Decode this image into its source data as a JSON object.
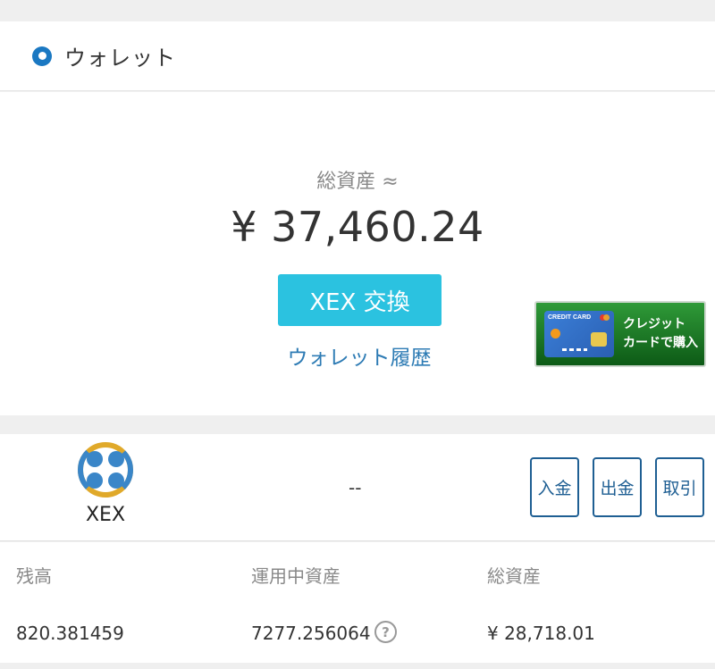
{
  "header": {
    "title": "ウォレット"
  },
  "summary": {
    "total_label": "総資産 ≈",
    "total_value": "¥ 37,460.24",
    "exchange_button": "XEX 交換",
    "history_link": "ウォレット履歴"
  },
  "banner": {
    "card_text": "CREDIT CARD",
    "line1": "クレジット",
    "line2": "カードで購入"
  },
  "coin": {
    "name": "XEX",
    "price": "--",
    "deposit": "入金",
    "withdraw": "出金",
    "trade": "取引"
  },
  "balances": {
    "balance_label": "残高",
    "balance_value": "820.381459",
    "in_use_label": "運用中資産",
    "in_use_value": "7277.256064",
    "total_label": "総資産",
    "total_value": "¥ 28,718.01",
    "help": "?"
  },
  "colors": {
    "accent": "#2bc2e0",
    "link": "#2d7bb4",
    "button_border": "#1f5f93",
    "icon_blue": "#1a78c2"
  }
}
